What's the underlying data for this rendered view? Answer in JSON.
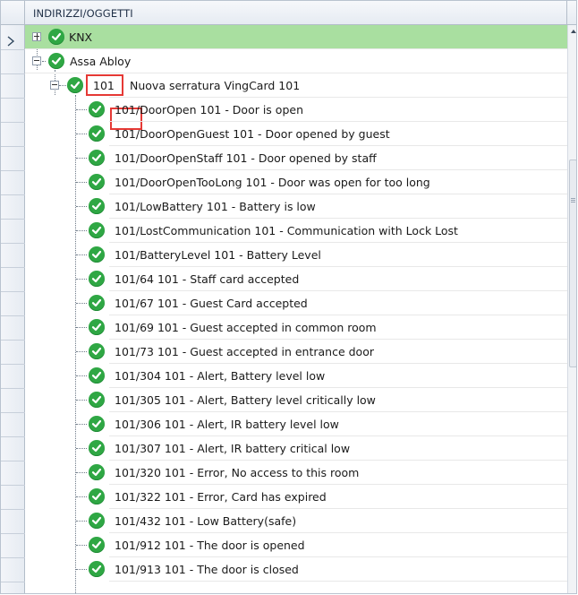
{
  "header": {
    "column_title": "INDIRIZZI/OGGETTI"
  },
  "tree": {
    "root_knx": {
      "label": "KNX"
    },
    "assa": {
      "label": "Assa Abloy"
    },
    "lock": {
      "id": "101",
      "name": "Nuova serratura VingCard 101"
    },
    "items": [
      {
        "label": "101/DoorOpen 101 - Door is open"
      },
      {
        "label": "101/DoorOpenGuest 101 - Door opened by guest"
      },
      {
        "label": "101/DoorOpenStaff 101 - Door opened by staff"
      },
      {
        "label": "101/DoorOpenTooLong 101 - Door was open for too long"
      },
      {
        "label": "101/LowBattery 101 - Battery is low"
      },
      {
        "label": "101/LostCommunication 101 - Communication with Lock Lost"
      },
      {
        "label": "101/BatteryLevel 101 - Battery Level"
      },
      {
        "label": "101/64 101 - Staff card accepted"
      },
      {
        "label": "101/67 101 - Guest Card accepted"
      },
      {
        "label": "101/69 101 - Guest accepted in common room"
      },
      {
        "label": "101/73 101 - Guest accepted in entrance door"
      },
      {
        "label": "101/304 101 - Alert, Battery level low"
      },
      {
        "label": "101/305 101 - Alert, Battery level critically low"
      },
      {
        "label": "101/306 101 - Alert, IR battery level low"
      },
      {
        "label": "101/307 101 - Alert, IR battery critical low"
      },
      {
        "label": "101/320 101 - Error, No access to this room"
      },
      {
        "label": "101/322 101 - Error, Card has expired"
      },
      {
        "label": "101/432 101 - Low Battery(safe)"
      },
      {
        "label": "101/912 101 - The door is opened"
      },
      {
        "label": "101/913 101 - The door is closed"
      }
    ]
  },
  "icons": {
    "status": "check-circle-icon",
    "expand": "plus-box-icon",
    "collapse": "minus-box-icon",
    "current_row": "row-pointer-icon"
  },
  "colors": {
    "selected_row": "#a9dfa0",
    "status_ok": "#2fa744",
    "highlight_box": "#e53935"
  }
}
